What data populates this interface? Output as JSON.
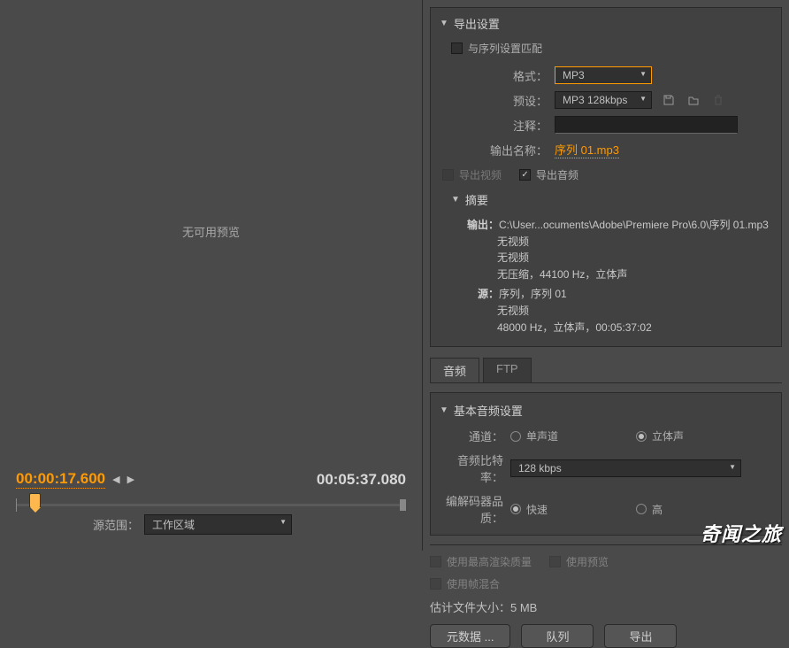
{
  "preview": {
    "no_preview": "无可用预览"
  },
  "timeline": {
    "current": "00:00:17.600",
    "total": "00:05:37.080",
    "source_label": "源范围：",
    "source_value": "工作区域"
  },
  "export": {
    "title": "导出设置",
    "match_seq": "与序列设置匹配",
    "format_label": "格式：",
    "format_value": "MP3",
    "preset_label": "预设：",
    "preset_value": "MP3 128kbps",
    "comment_label": "注释：",
    "output_label": "输出名称：",
    "output_value": "序列 01.mp3",
    "export_video": "导出视频",
    "export_audio": "导出音频"
  },
  "summary": {
    "title": "摘要",
    "output_label": "输出：",
    "output_path": "C:\\User...ocuments\\Adobe\\Premiere Pro\\6.0\\序列 01.mp3",
    "line2": "无视频",
    "line3": "无视频",
    "line4": "无压缩，44100 Hz，立体声",
    "source_label": "源：",
    "source_line1": "序列，序列 01",
    "source_line2": "无视频",
    "source_line3": "48000 Hz，立体声，00:05:37:02"
  },
  "tabs": {
    "audio": "音频",
    "ftp": "FTP"
  },
  "audio_settings": {
    "title": "基本音频设置",
    "channel_label": "通道：",
    "mono": "单声道",
    "stereo": "立体声",
    "bitrate_label": "音频比特率：",
    "bitrate_value": "128 kbps",
    "quality_label": "编解码器品质：",
    "fast": "快速",
    "high": "高"
  },
  "bottom": {
    "max_render": "使用最高渲染质量",
    "use_preview": "使用预览",
    "frame_blend": "使用帧混合",
    "filesize_label": "估计文件大小：",
    "filesize_value": "5 MB",
    "metadata_btn": "元数据 ...",
    "queue_btn": "队列",
    "export_btn": "导出"
  },
  "watermark": "奇闻之旅"
}
